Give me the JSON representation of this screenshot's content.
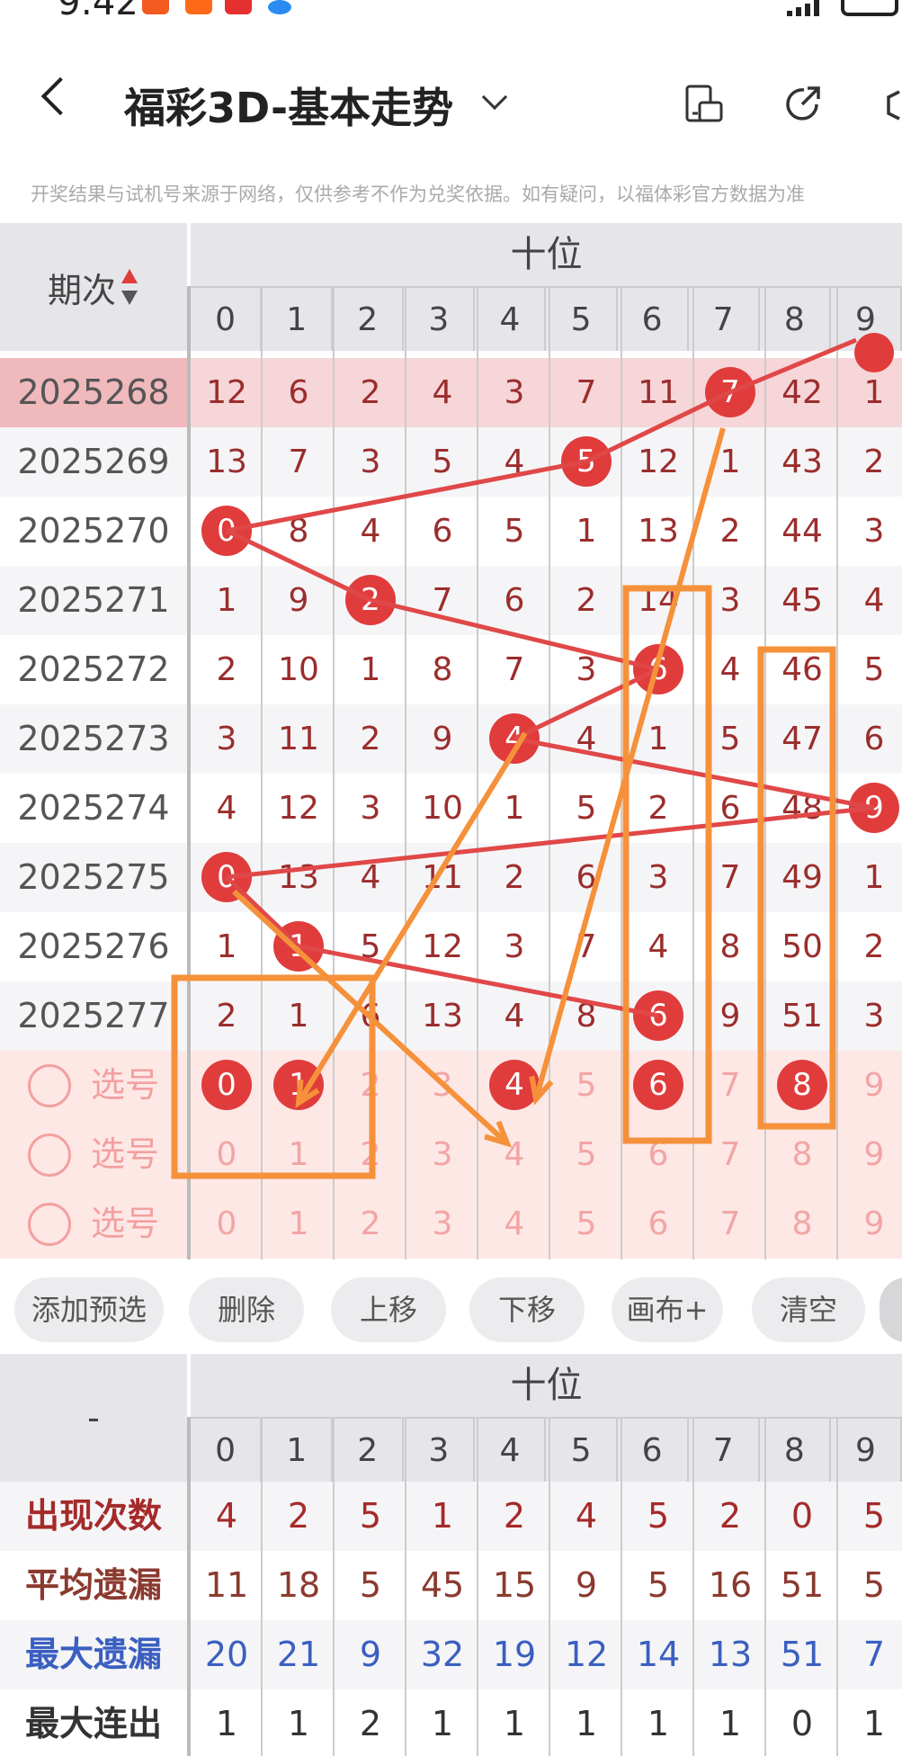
{
  "status": {
    "time": "9:42"
  },
  "title": {
    "text": "福彩3D-基本走势"
  },
  "notice": "开奖结果与试机号来源于网络，仅供参考不作为兑奖依据。如有疑问，以福体彩官方数据为准",
  "table": {
    "header_left": "期次",
    "group_label": "十位",
    "digits": [
      "0",
      "1",
      "2",
      "3",
      "4",
      "5",
      "6",
      "7",
      "8",
      "9"
    ],
    "rows": [
      {
        "issue": "2025268",
        "cells": [
          "12",
          "6",
          "2",
          "4",
          "3",
          "7",
          "11",
          "7",
          "42",
          "1"
        ],
        "ball": 7
      },
      {
        "issue": "2025269",
        "cells": [
          "13",
          "7",
          "3",
          "5",
          "4",
          "5",
          "12",
          "1",
          "43",
          "2"
        ],
        "ball": 5
      },
      {
        "issue": "2025270",
        "cells": [
          "0",
          "8",
          "4",
          "6",
          "5",
          "1",
          "13",
          "2",
          "44",
          "3"
        ],
        "ball": 0
      },
      {
        "issue": "2025271",
        "cells": [
          "1",
          "9",
          "2",
          "7",
          "6",
          "2",
          "14",
          "3",
          "45",
          "4"
        ],
        "ball": 2
      },
      {
        "issue": "2025272",
        "cells": [
          "2",
          "10",
          "1",
          "8",
          "7",
          "3",
          "6",
          "4",
          "46",
          "5"
        ],
        "ball": 6
      },
      {
        "issue": "2025273",
        "cells": [
          "3",
          "11",
          "2",
          "9",
          "4",
          "4",
          "1",
          "5",
          "47",
          "6"
        ],
        "ball": 4
      },
      {
        "issue": "2025274",
        "cells": [
          "4",
          "12",
          "3",
          "10",
          "1",
          "5",
          "2",
          "6",
          "48",
          "9"
        ],
        "ball": 9
      },
      {
        "issue": "2025275",
        "cells": [
          "0",
          "13",
          "4",
          "11",
          "2",
          "6",
          "3",
          "7",
          "49",
          "1"
        ],
        "ball": 0
      },
      {
        "issue": "2025276",
        "cells": [
          "1",
          "1",
          "5",
          "12",
          "3",
          "7",
          "4",
          "8",
          "50",
          "2"
        ],
        "ball": 1
      },
      {
        "issue": "2025277",
        "cells": [
          "2",
          "1",
          "6",
          "13",
          "4",
          "8",
          "6",
          "9",
          "51",
          "3"
        ],
        "ball": 6
      }
    ],
    "select_label": "选号",
    "select_rows": [
      {
        "cells": [
          "0",
          "1",
          "2",
          "3",
          "4",
          "5",
          "6",
          "7",
          "8",
          "9"
        ],
        "picked": [
          0,
          1,
          4,
          6,
          8
        ]
      },
      {
        "cells": [
          "0",
          "1",
          "2",
          "3",
          "4",
          "5",
          "6",
          "7",
          "8",
          "9"
        ],
        "picked": []
      },
      {
        "cells": [
          "0",
          "1",
          "2",
          "3",
          "4",
          "5",
          "6",
          "7",
          "8",
          "9"
        ],
        "picked": []
      }
    ]
  },
  "buttons": [
    "添加预选",
    "删除",
    "上移",
    "下移",
    "画布+",
    "清空"
  ],
  "stats": {
    "header_left": "-",
    "group_label": "十位",
    "digits": [
      "0",
      "1",
      "2",
      "3",
      "4",
      "5",
      "6",
      "7",
      "8",
      "9"
    ],
    "rows": [
      {
        "label": "出现次数",
        "color": "#a52a2a",
        "values": [
          "4",
          "2",
          "5",
          "1",
          "2",
          "4",
          "5",
          "2",
          "0",
          "5"
        ]
      },
      {
        "label": "平均遗漏",
        "color": "#8b3a2f",
        "values": [
          "11",
          "18",
          "5",
          "45",
          "15",
          "9",
          "5",
          "16",
          "51",
          "5"
        ]
      },
      {
        "label": "最大遗漏",
        "color": "#3a5fc0",
        "values": [
          "20",
          "21",
          "9",
          "32",
          "19",
          "12",
          "14",
          "13",
          "51",
          "7"
        ]
      },
      {
        "label": "最大连出",
        "color": "#333333",
        "values": [
          "1",
          "1",
          "2",
          "1",
          "1",
          "1",
          "1",
          "1",
          "0",
          "1"
        ]
      }
    ]
  },
  "colors": {
    "ball": "#e03c3c",
    "line": "#e04848",
    "annotation": "#f5913a"
  }
}
